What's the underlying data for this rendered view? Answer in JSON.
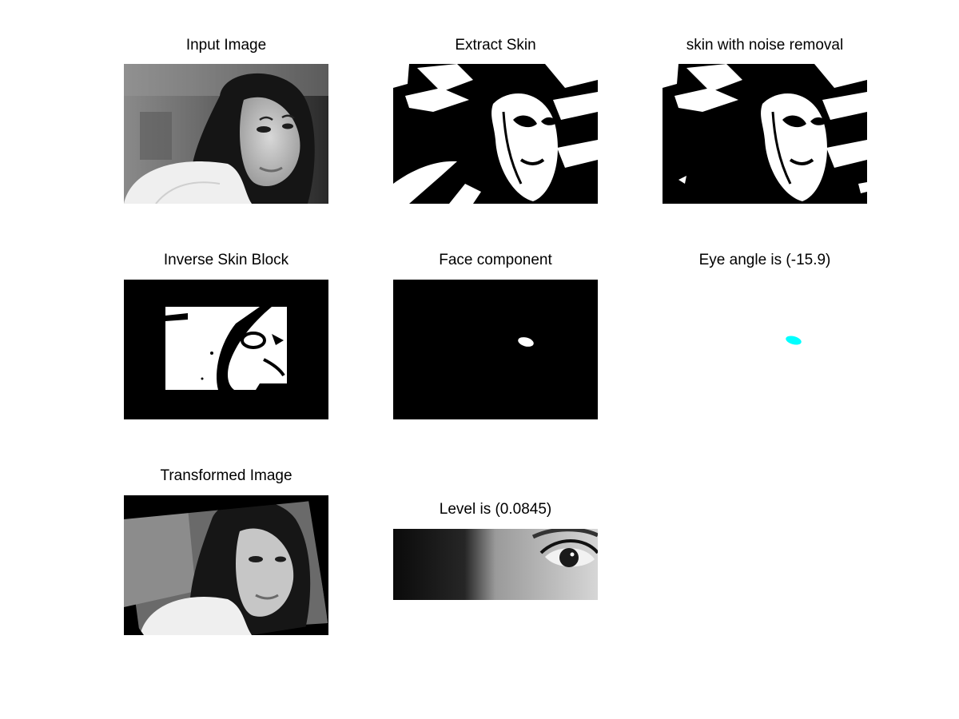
{
  "figure": {
    "background": "#ffffff",
    "panels": [
      {
        "title": "Input Image",
        "content": "grayscale portrait photo"
      },
      {
        "title": "Extract Skin",
        "content": "binary skin mask"
      },
      {
        "title": "skin with noise removal",
        "content": "binary skin mask, denoised"
      },
      {
        "title": "Inverse Skin Block",
        "content": "inverted skin block mask"
      },
      {
        "title": "Face component",
        "content": "single white eye blob on black"
      },
      {
        "title": "Eye angle is (-15.9)",
        "content": "cyan eye blob on white",
        "blob_color": "#00ffff"
      },
      {
        "title": "Transformed Image",
        "content": "rotated grayscale portrait"
      },
      {
        "title": "Level is (0.0845)",
        "content": "cropped eye region"
      }
    ]
  }
}
